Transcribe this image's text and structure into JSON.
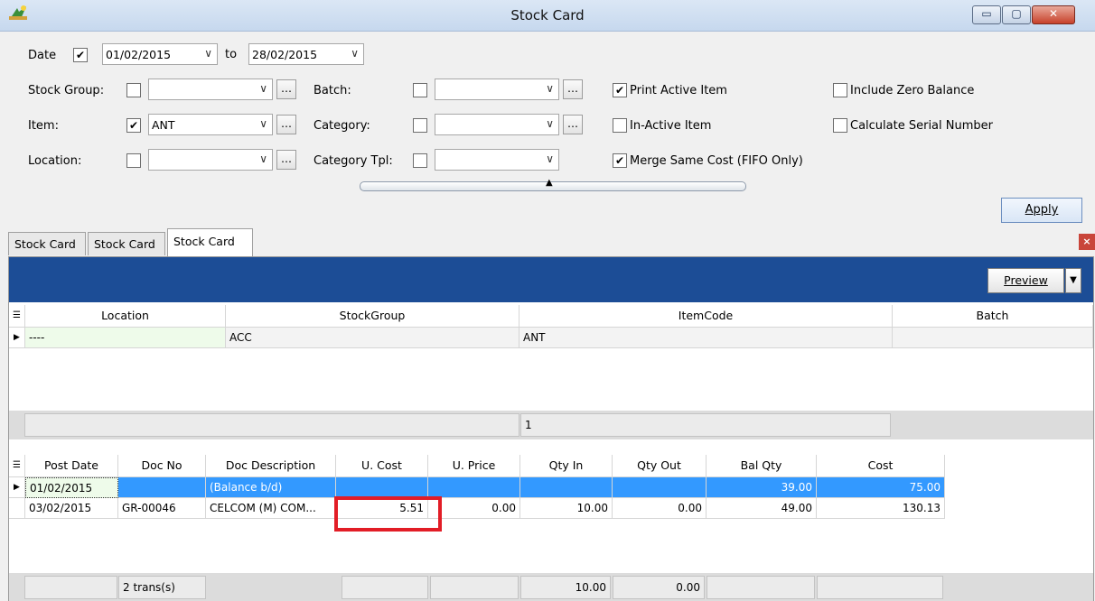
{
  "window": {
    "title": "Stock Card",
    "minimize": "▭",
    "maximize": "▢",
    "close": "✕"
  },
  "filters": {
    "date_label": "Date",
    "date_checked": "✔",
    "date_from": "01/02/2015",
    "to_label": "to",
    "date_to": "28/02/2015",
    "stock_group_label": "Stock Group:",
    "stock_group_value": "",
    "item_label": "Item:",
    "item_checked": "✔",
    "item_value": "ANT",
    "location_label": "Location:",
    "location_value": "",
    "batch_label": "Batch:",
    "category_label": "Category:",
    "category_tpl_label": "Category Tpl:",
    "print_active_label": "Print Active Item",
    "print_active_checked": "✔",
    "inactive_label": "In-Active Item",
    "merge_cost_label": "Merge Same Cost (FIFO Only)",
    "merge_cost_checked": "✔",
    "zero_balance_label": "Include Zero Balance",
    "serial_label": "Calculate Serial Number",
    "ellipsis": "…",
    "arrow": "∨"
  },
  "apply_label": "Apply",
  "tabs": [
    {
      "label": "Stock Card"
    },
    {
      "label": "Stock Card"
    },
    {
      "label": "Stock Card"
    }
  ],
  "tab_close": "×",
  "preview_label": "Preview",
  "preview_drop": "▼",
  "grid1": {
    "columns": [
      "Location",
      "StockGroup",
      "ItemCode",
      "Batch"
    ],
    "row": [
      "----",
      "ACC",
      "ANT",
      ""
    ],
    "footer_count": "1"
  },
  "grid2": {
    "columns": [
      "Post Date",
      "Doc No",
      "Doc Description",
      "U. Cost",
      "U. Price",
      "Qty In",
      "Qty Out",
      "Bal Qty",
      "Cost"
    ],
    "rows": [
      [
        "01/02/2015",
        "",
        "(Balance b/d)",
        "",
        "",
        "",
        "",
        "39.00",
        "75.00"
      ],
      [
        "03/02/2015",
        "GR-00046",
        "CELCOM (M) COM...",
        "5.51",
        "0.00",
        "10.00",
        "0.00",
        "49.00",
        "130.13"
      ]
    ],
    "footer": {
      "trans": "2 trans(s)",
      "qty_in": "10.00",
      "qty_out": "0.00"
    }
  },
  "colors": {
    "blue_bar": "#1c4d96",
    "selected_row": "#3399ff",
    "highlight": "#e21d26"
  }
}
